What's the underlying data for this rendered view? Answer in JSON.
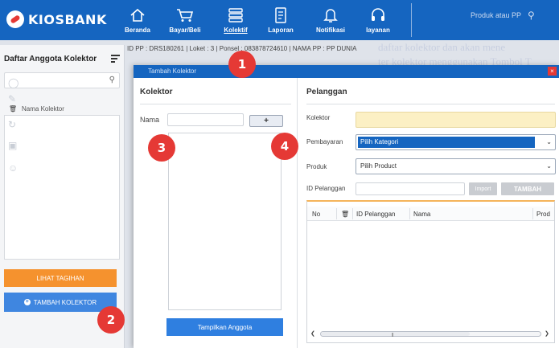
{
  "brand": {
    "name": "KIOSBANK"
  },
  "nav": {
    "items": [
      {
        "label": "Beranda",
        "icon": "home-icon"
      },
      {
        "label": "Bayar/Beli",
        "icon": "cart-icon"
      },
      {
        "label": "Kolektif",
        "icon": "list-icon",
        "active": true
      },
      {
        "label": "Laporan",
        "icon": "document-icon"
      },
      {
        "label": "Notifikasi",
        "icon": "bell-icon"
      },
      {
        "label": "layanan",
        "icon": "headset-icon"
      }
    ],
    "search_hint": "Produk atau PP"
  },
  "background_text": {
    "line1": "daftar kolektor dan akan mene",
    "line2": "ter kolektor menggunakan Tombol T"
  },
  "left_panel": {
    "title": "Daftar Anggota Kolektor",
    "list_header": "Nama Kolektor",
    "lihat_button": "LIHAT TAGIHAN",
    "tambah_button": "TAMBAH KOLEKTOR"
  },
  "info_strip": "ID PP : DRS180261 | Loket : 3 | Ponsel : 083878724610 | NAMA PP : PP DUNIA",
  "modal": {
    "title": "Tambah Kolektor",
    "close_glyph": "×",
    "kolektor": {
      "title": "Kolektor",
      "nama_label": "Nama",
      "add_glyph": "+",
      "show_button": "Tampilkan Anggota"
    },
    "pelanggan": {
      "title": "Pelanggan",
      "kolektor_label": "Kolektor",
      "pembayaran_label": "Pembayaran",
      "pembayaran_value": "Pilih Kategori",
      "produk_label": "Produk",
      "produk_value": "Pilih Product",
      "id_label": "ID Pelanggan",
      "import_button": "Import",
      "tambah_button": "TAMBAH",
      "columns": [
        "No",
        "ID Pelanggan",
        "Nama",
        "Prod"
      ]
    }
  },
  "badges": [
    "1",
    "2",
    "3",
    "4"
  ],
  "colors": {
    "primary": "#1565c0",
    "accent": "#e53935",
    "orange": "#f5922e"
  }
}
